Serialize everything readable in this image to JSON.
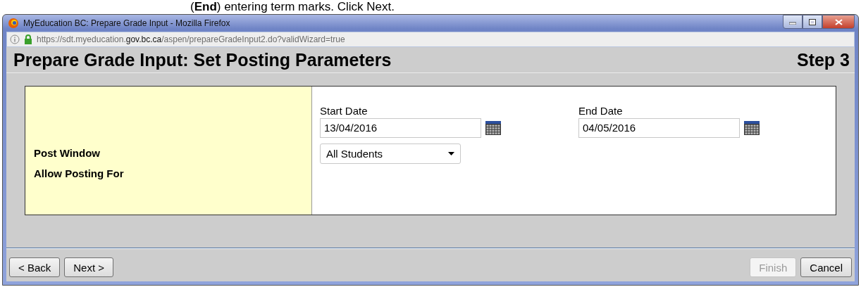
{
  "caption": "(**End**) entering term marks. Click Next.",
  "window": {
    "title": "MyEducation BC: Prepare Grade Input - Mozilla Firefox"
  },
  "address_bar": {
    "before": "https://sdt.myeducation.",
    "domain": "gov.bc.ca",
    "after": "/aspen/prepareGradeInput2.do?validWizard=true"
  },
  "header": {
    "title": "Prepare Grade Input: Set Posting Parameters",
    "step": "Step 3"
  },
  "form": {
    "labels": [
      "Post Window",
      "Allow Posting For"
    ],
    "dates": [
      {
        "label": "Start Date",
        "value": "13/04/2016"
      },
      {
        "label": "End Date",
        "value": "04/05/2016"
      }
    ],
    "posting_for": {
      "value": "All Students"
    }
  },
  "buttons_left": [
    {
      "label": "< Back",
      "disabled": false
    },
    {
      "label": "Next >",
      "disabled": false
    }
  ],
  "buttons_right": [
    {
      "label": "Finish",
      "disabled": true
    },
    {
      "label": "Cancel",
      "disabled": false
    }
  ]
}
